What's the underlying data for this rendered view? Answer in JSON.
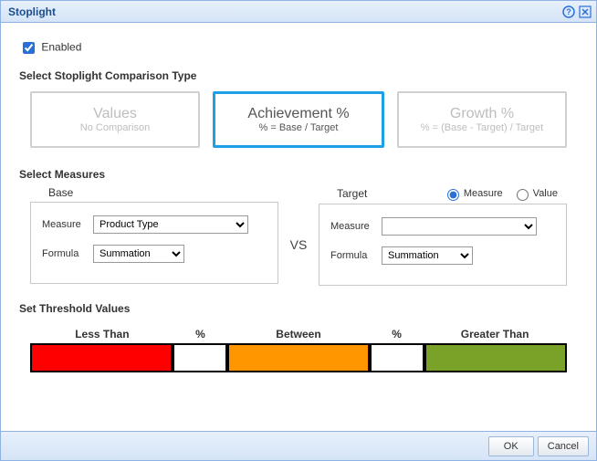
{
  "dialog": {
    "title": "Stoplight"
  },
  "enabled": {
    "label": "Enabled",
    "checked": true
  },
  "comparison": {
    "heading": "Select Stoplight Comparison Type",
    "cards": [
      {
        "title": "Values",
        "sub": "No Comparison",
        "selected": false
      },
      {
        "title": "Achievement %",
        "sub": "% = Base / Target",
        "selected": true
      },
      {
        "title": "Growth %",
        "sub": "% = (Base - Target) / Target",
        "selected": false
      }
    ]
  },
  "measures": {
    "heading": "Select Measures",
    "vs_label": "VS",
    "base": {
      "title": "Base",
      "measure_label": "Measure",
      "measure_value": "Product Type",
      "formula_label": "Formula",
      "formula_value": "Summation"
    },
    "target": {
      "title": "Target",
      "radios": {
        "measure_label": "Measure",
        "value_label": "Value",
        "selected": "measure"
      },
      "measure_label": "Measure",
      "measure_value": "",
      "formula_label": "Formula",
      "formula_value": "Summation"
    }
  },
  "thresholds": {
    "heading": "Set Threshold Values",
    "headers": [
      "Less Than",
      "%",
      "Between",
      "%",
      "Greater Than"
    ],
    "colors": [
      "#ff0000",
      "#ffffff",
      "#ff9600",
      "#ffffff",
      "#7aa228"
    ]
  },
  "footer": {
    "ok": "OK",
    "cancel": "Cancel"
  }
}
